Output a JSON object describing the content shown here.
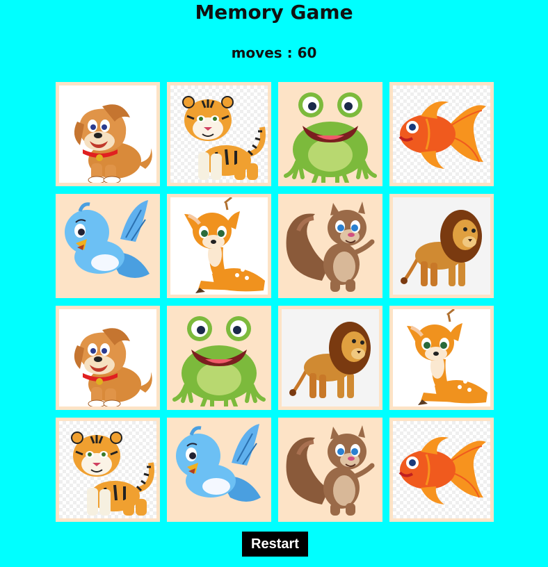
{
  "title": "Memory Game",
  "moves_text": "moves : 60",
  "moves_count": 60,
  "restart_label": "Restart",
  "colors": {
    "background": "#00ffff",
    "card_frame": "#fde3c6",
    "button": "#000000",
    "button_text": "#ffffff"
  },
  "cards": [
    {
      "animal": "dog",
      "icon": "dog-icon"
    },
    {
      "animal": "tiger",
      "icon": "tiger-icon"
    },
    {
      "animal": "frog",
      "icon": "frog-icon"
    },
    {
      "animal": "fish",
      "icon": "fish-icon"
    },
    {
      "animal": "bird",
      "icon": "bird-icon"
    },
    {
      "animal": "deer",
      "icon": "deer-icon"
    },
    {
      "animal": "squirrel",
      "icon": "squirrel-icon"
    },
    {
      "animal": "lion",
      "icon": "lion-icon"
    },
    {
      "animal": "dog",
      "icon": "dog-icon"
    },
    {
      "animal": "frog",
      "icon": "frog-icon"
    },
    {
      "animal": "lion",
      "icon": "lion-icon"
    },
    {
      "animal": "deer",
      "icon": "deer-icon"
    },
    {
      "animal": "tiger",
      "icon": "tiger-icon"
    },
    {
      "animal": "bird",
      "icon": "bird-icon"
    },
    {
      "animal": "squirrel",
      "icon": "squirrel-icon"
    },
    {
      "animal": "fish",
      "icon": "fish-icon"
    }
  ]
}
